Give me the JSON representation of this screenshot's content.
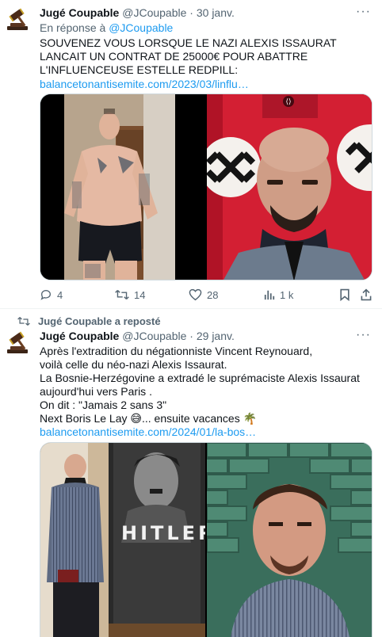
{
  "tweet1": {
    "author_name": "Jugé Coupable",
    "handle": "@JCoupable",
    "separator": "·",
    "date": "30 janv.",
    "reply_prefix": "En réponse à",
    "reply_to": "@JCoupable",
    "text": "SOUVENEZ VOUS LORSQUE LE NAZI ALEXIS ISSAURAT LANCAIT UN CONTRAT DE 25000€ POUR ABATTRE L'INFLUENCEUSE ESTELLE REDPILL:",
    "link": "balancetonantisemite.com/2023/03/linflu…",
    "stats": {
      "replies": "4",
      "reposts": "14",
      "likes": "28",
      "views": "1 k"
    }
  },
  "tweet2": {
    "repost_label": "Jugé Coupable a reposté",
    "author_name": "Jugé Coupable",
    "handle": "@JCoupable",
    "separator": "·",
    "date": "29 janv.",
    "lines": [
      "Après l'extradition du négationniste Vincent Reynouard,",
      "voilà celle du néo-nazi Alexis Issaurat.",
      "La Bosnie-Herzégovine a extradé le suprémaciste Alexis Issaurat",
      "aujourd'hui vers Paris .",
      "On dit : \"Jamais 2 sans 3\"",
      "Next Boris Le Lay 😅... ensuite vacances 🌴"
    ],
    "link": "balancetonantisemite.com/2024/01/la-bos…",
    "poster_text": "HITLER"
  },
  "icons": {
    "more": "more-horizontal-icon",
    "reply": "reply-icon",
    "repost": "repost-icon",
    "like": "heart-icon",
    "views": "views-icon",
    "bookmark": "bookmark-icon",
    "share": "share-icon"
  },
  "colors": {
    "link": "#1d9bf0",
    "secondary": "#536471",
    "text": "#0f1419"
  }
}
